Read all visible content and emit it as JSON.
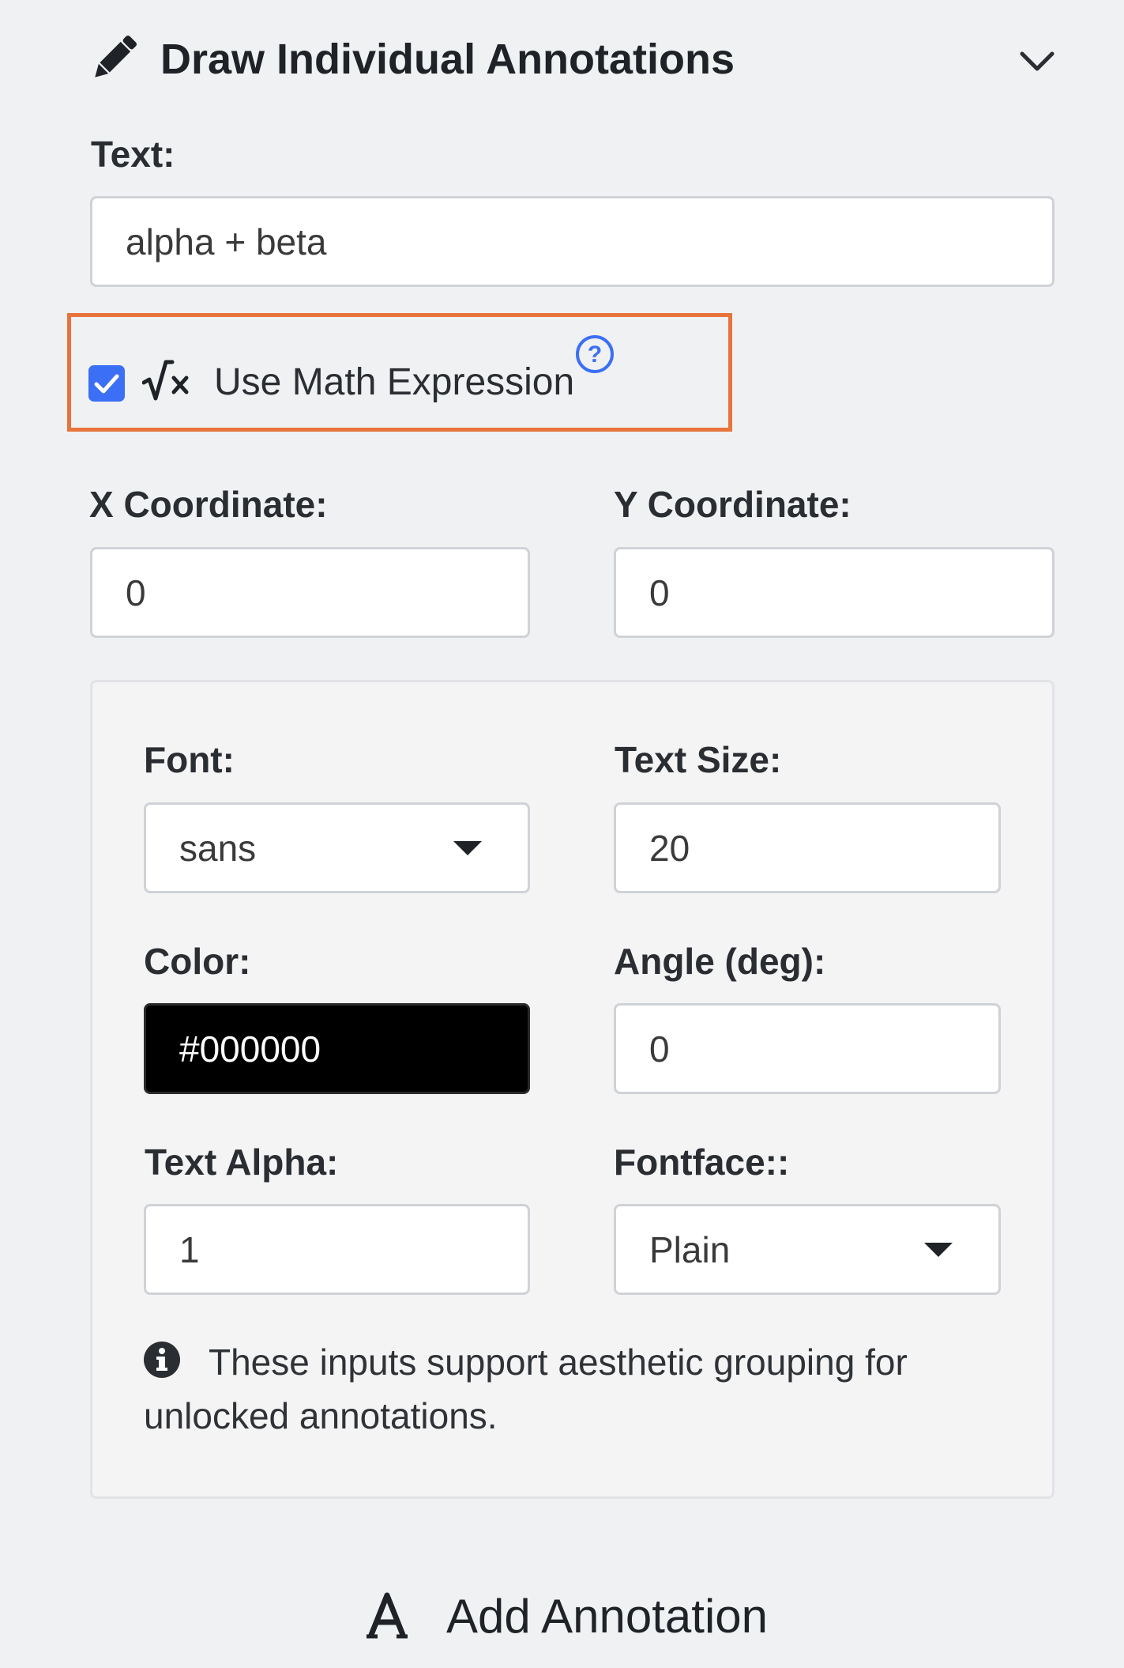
{
  "header": {
    "title": "Draw Individual Annotations",
    "icon": "pencil-icon",
    "toggle_icon": "chevron-down-icon"
  },
  "text_field": {
    "label": "Text:",
    "value": "alpha + beta"
  },
  "math_expression": {
    "label": "Use Math Expression",
    "checked": true,
    "icon": "square-root-icon",
    "help_icon": "question-circle-icon",
    "highlight_color": "#e8743b"
  },
  "coordinates": {
    "x_label": "X Coordinate:",
    "x_value": "0",
    "y_label": "Y Coordinate:",
    "y_value": "0"
  },
  "style_panel": {
    "font_label": "Font:",
    "font_value": "sans",
    "text_size_label": "Text Size:",
    "text_size_value": "20",
    "color_label": "Color:",
    "color_value": "#000000",
    "angle_label": "Angle (deg):",
    "angle_value": "0",
    "alpha_label": "Text Alpha:",
    "alpha_value": "1",
    "fontface_label": "Fontface::",
    "fontface_value": "Plain",
    "info_line1": "These inputs support aesthetic grouping for",
    "info_line2": "unlocked annotations.",
    "info_icon": "info-circle-icon"
  },
  "add_button": {
    "label": "Add Annotation",
    "icon": "text-a-icon"
  },
  "colors": {
    "accent": "#3b6ff5",
    "background": "#f0f1f3"
  }
}
